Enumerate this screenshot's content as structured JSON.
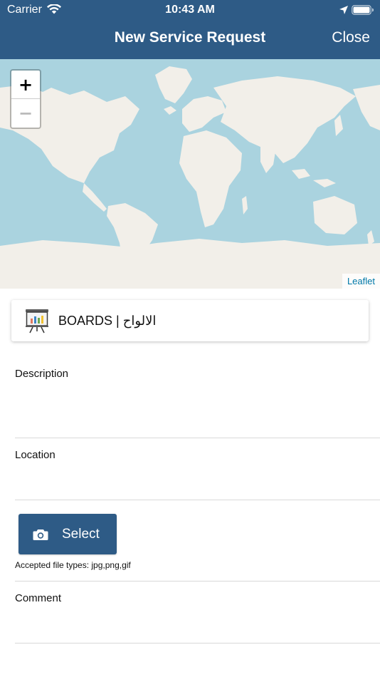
{
  "status_bar": {
    "carrier": "Carrier",
    "time": "10:43 AM"
  },
  "nav": {
    "title": "New Service Request",
    "close_label": "Close"
  },
  "map": {
    "zoom_in": "+",
    "zoom_out": "−",
    "attribution": "Leaflet"
  },
  "category": {
    "label": "BOARDS | الالواح",
    "icon": "presentation-board-icon"
  },
  "form": {
    "description_label": "Description",
    "location_label": "Location",
    "select_label": "Select",
    "accepted_types": "Accepted file types: jpg,png,gif",
    "comment_label": "Comment"
  },
  "colors": {
    "header": "#2e5b86",
    "water": "#aad3df",
    "land": "#f2efe9",
    "button": "#2e5b86"
  }
}
